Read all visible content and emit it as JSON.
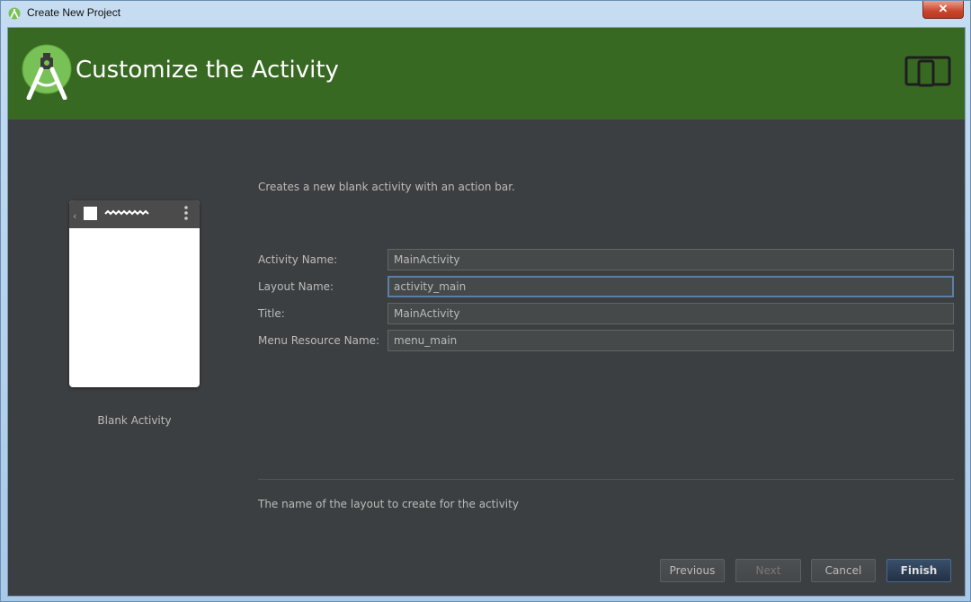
{
  "window": {
    "title": "Create New Project",
    "close_label": "✕"
  },
  "banner": {
    "heading": "Customize the Activity"
  },
  "description": "Creates a new blank activity with an action bar.",
  "preview": {
    "label": "Blank Activity"
  },
  "form": {
    "activity_name": {
      "label": "Activity Name:",
      "value": "MainActivity"
    },
    "layout_name": {
      "label": "Layout Name:",
      "value": "activity_main"
    },
    "title": {
      "label": "Title:",
      "value": "MainActivity"
    },
    "menu_resource_name": {
      "label": "Menu Resource Name:",
      "value": "menu_main"
    }
  },
  "hint": "The name of the layout to create for the activity",
  "buttons": {
    "previous": "Previous",
    "next": "Next",
    "cancel": "Cancel",
    "finish": "Finish"
  },
  "colors": {
    "banner": "#386922",
    "panel": "#3c3f41",
    "accent": "#5a7fa8"
  }
}
